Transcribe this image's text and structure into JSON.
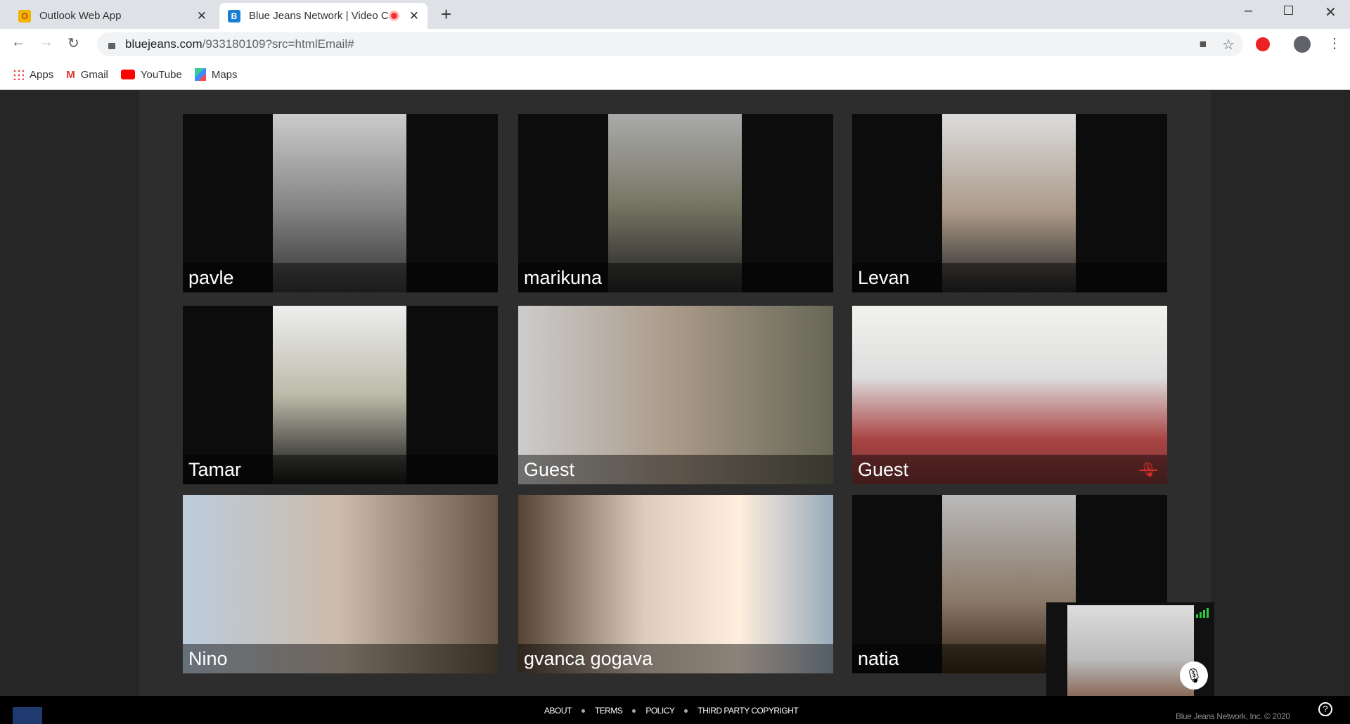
{
  "browser": {
    "tabs": [
      {
        "title": "Outlook Web App",
        "icon": "outlook-icon",
        "active": false
      },
      {
        "title": "Blue Jeans Network | Video C",
        "icon": "bluejeans-icon",
        "active": true,
        "recording": true
      }
    ],
    "url_host": "bluejeans.com",
    "url_path": "/933180109?src=htmlEmail#",
    "bookmarks": [
      {
        "label": "Apps",
        "icon": "apps-grid-icon"
      },
      {
        "label": "Gmail",
        "icon": "gmail-icon"
      },
      {
        "label": "YouTube",
        "icon": "youtube-icon"
      },
      {
        "label": "Maps",
        "icon": "maps-icon"
      }
    ]
  },
  "participants": [
    {
      "name": "pavle",
      "muted": false
    },
    {
      "name": "marikuna",
      "muted": false
    },
    {
      "name": "Levan",
      "muted": false
    },
    {
      "name": "Tamar",
      "muted": false
    },
    {
      "name": "Guest",
      "muted": false
    },
    {
      "name": "Guest",
      "muted": true
    },
    {
      "name": "Nino",
      "muted": false
    },
    {
      "name": "gvanca gogava",
      "muted": false
    },
    {
      "name": "natia",
      "muted": false
    }
  ],
  "footer": {
    "links": [
      "ABOUT",
      "TERMS",
      "POLICY",
      "THIRD PARTY COPYRIGHT"
    ],
    "copyright": "Blue Jeans Network, Inc. © 2020"
  },
  "colors": {
    "accent": "#1a73e8",
    "mute": "#d93025",
    "signal": "#2ecc40"
  }
}
